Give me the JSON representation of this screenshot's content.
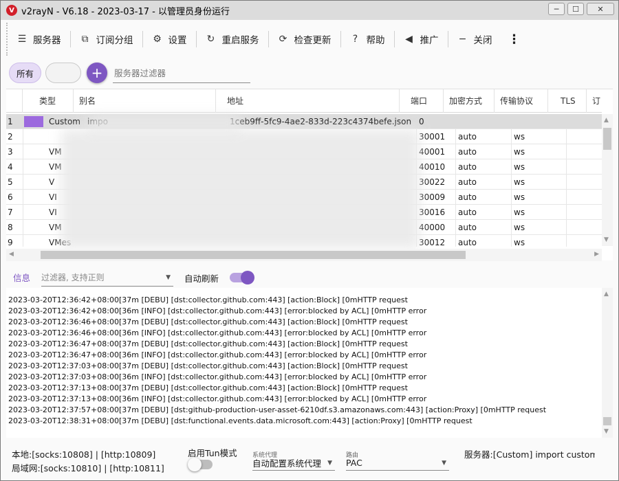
{
  "window": {
    "title": "v2rayN - V6.18 - 2023-03-17 - 以管理员身份运行",
    "logo_text": "V",
    "min_glyph": "─",
    "max_glyph": "☐",
    "close_glyph": "✕"
  },
  "toolbar": {
    "items": [
      {
        "label": "服务器",
        "icon": "server-icon",
        "glyph": "☰"
      },
      {
        "label": "订阅分组",
        "icon": "subscription-icon",
        "glyph": "⧉"
      },
      {
        "label": "设置",
        "icon": "gear-icon",
        "glyph": "⚙"
      },
      {
        "label": "重启服务",
        "icon": "restart-icon",
        "glyph": "↻"
      },
      {
        "label": "检查更新",
        "icon": "update-icon",
        "glyph": "⟳"
      },
      {
        "label": "帮助",
        "icon": "help-icon",
        "glyph": "?"
      },
      {
        "label": "推广",
        "icon": "promote-icon",
        "glyph": "◀"
      },
      {
        "label": "关闭",
        "icon": "close-icon",
        "glyph": "−"
      }
    ],
    "more_glyph": "⋮"
  },
  "filter": {
    "all_label": "所有",
    "add_glyph": "+",
    "server_filter_placeholder": "服务器过滤器"
  },
  "grid": {
    "columns": [
      "类型",
      "别名",
      "地址",
      "端口",
      "加密方式",
      "传输协议",
      "TLS",
      "订"
    ],
    "rows": [
      {
        "num": "1",
        "type": "Custom",
        "name": "impo",
        "address": "1ceb9ff-5fc9-4ae2-833d-223c4374befe.json",
        "port": "0",
        "encryption": "",
        "network": "",
        "selected": true
      },
      {
        "num": "2",
        "type": "",
        "name": "",
        "address": "",
        "port": "30001",
        "encryption": "auto",
        "network": "ws",
        "selected": false
      },
      {
        "num": "3",
        "type": "VM",
        "name": "",
        "address": "",
        "port": "40001",
        "encryption": "auto",
        "network": "ws",
        "selected": false
      },
      {
        "num": "4",
        "type": "VM",
        "name": "",
        "address": "",
        "port": "40010",
        "encryption": "auto",
        "network": "ws",
        "selected": false
      },
      {
        "num": "5",
        "type": "V",
        "name": "",
        "address": "",
        "port": "30022",
        "encryption": "auto",
        "network": "ws",
        "selected": false
      },
      {
        "num": "6",
        "type": "VI",
        "name": "",
        "address": "",
        "port": "30009",
        "encryption": "auto",
        "network": "ws",
        "selected": false
      },
      {
        "num": "7",
        "type": "VI",
        "name": "",
        "address": "",
        "port": "30016",
        "encryption": "auto",
        "network": "ws",
        "selected": false
      },
      {
        "num": "8",
        "type": "VM",
        "name": "",
        "address": "",
        "port": "40000",
        "encryption": "auto",
        "network": "ws",
        "selected": false
      },
      {
        "num": "9",
        "type": "VMes",
        "name": "",
        "address": "",
        "port": "30012",
        "encryption": "auto",
        "network": "ws",
        "selected": false
      }
    ],
    "custom_marker_color": "#9c6ade"
  },
  "log": {
    "tab_label": "信息",
    "filter_placeholder": "过滤器, 支持正则",
    "auto_refresh_label": "自动刷新",
    "auto_refresh_on": true,
    "lines": [
      "2023-03-20T12:36:42+08:00[37m [DEBU] [dst:collector.github.com:443] [action:Block] [0mHTTP request",
      "2023-03-20T12:36:42+08:00[36m [INFO] [dst:collector.github.com:443] [error:blocked by ACL] [0mHTTP error",
      "2023-03-20T12:36:46+08:00[37m [DEBU] [dst:collector.github.com:443] [action:Block] [0mHTTP request",
      "2023-03-20T12:36:46+08:00[36m [INFO] [dst:collector.github.com:443] [error:blocked by ACL] [0mHTTP error",
      "2023-03-20T12:36:47+08:00[37m [DEBU] [dst:collector.github.com:443] [action:Block] [0mHTTP request",
      "2023-03-20T12:36:47+08:00[36m [INFO] [dst:collector.github.com:443] [error:blocked by ACL] [0mHTTP error",
      "2023-03-20T12:37:03+08:00[37m [DEBU] [dst:collector.github.com:443] [action:Block] [0mHTTP request",
      "2023-03-20T12:37:03+08:00[36m [INFO] [dst:collector.github.com:443] [error:blocked by ACL] [0mHTTP error",
      "2023-03-20T12:37:13+08:00[37m [DEBU] [dst:collector.github.com:443] [action:Block] [0mHTTP request",
      "2023-03-20T12:37:13+08:00[36m [INFO] [dst:collector.github.com:443] [error:blocked by ACL] [0mHTTP error",
      "2023-03-20T12:37:57+08:00[37m [DEBU] [dst:github-production-user-asset-6210df.s3.amazonaws.com:443] [action:Proxy] [0mHTTP request",
      "2023-03-20T12:38:31+08:00[37m [DEBU] [dst:functional.events.data.microsoft.com:443] [action:Proxy] [0mHTTP request"
    ]
  },
  "status": {
    "local": "本地:[socks:10808] | [http:10809]",
    "lan": "局域网:[socks:10810] | [http:10811]",
    "tun_label": "启用Tun模式",
    "tun_on": false,
    "system_proxy_caption": "系统代理",
    "system_proxy_value": "自动配置系统代理",
    "route_caption": "路由",
    "route_value": "PAC",
    "server_text": "服务器:[Custom] import custom@"
  }
}
